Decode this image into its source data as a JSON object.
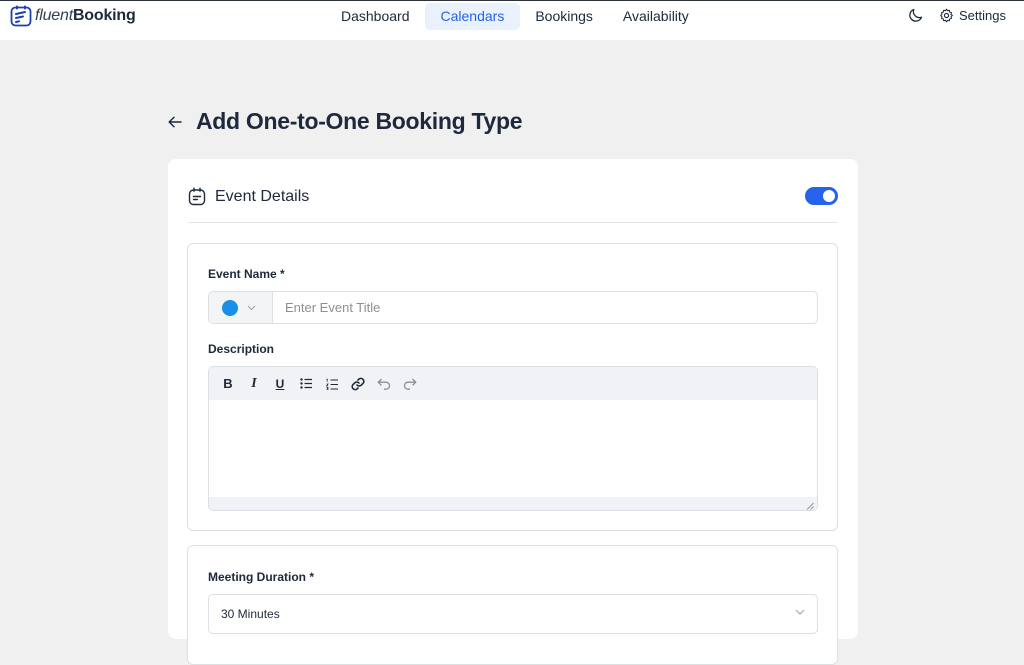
{
  "app": {
    "brand_light": "fluent",
    "brand_bold": "Booking",
    "accent": "#2563eb"
  },
  "nav": {
    "items": [
      {
        "label": "Dashboard",
        "active": false
      },
      {
        "label": "Calendars",
        "active": true
      },
      {
        "label": "Bookings",
        "active": false
      },
      {
        "label": "Availability",
        "active": false
      }
    ]
  },
  "top_right": {
    "theme_icon": "moon-icon",
    "settings_icon": "gear-icon",
    "settings_label": "Settings"
  },
  "page": {
    "back_icon": "arrow-left-icon",
    "title": "Add One-to-One Booking Type"
  },
  "event_details": {
    "icon": "calendar-note-icon",
    "title": "Event Details",
    "enabled": true,
    "event_name_label": "Event Name *",
    "event_color": "#1a8fe8",
    "event_title_placeholder": "Enter Event Title",
    "event_title_value": "",
    "description_label": "Description",
    "toolbar": [
      "bold",
      "italic",
      "underline",
      "bullet-list",
      "numbered-list",
      "link",
      "undo",
      "redo"
    ],
    "bold_label": "B",
    "italic_label": "I",
    "underline_label": "U"
  },
  "meeting": {
    "duration_label": "Meeting Duration *",
    "duration_value": "30 Minutes"
  }
}
